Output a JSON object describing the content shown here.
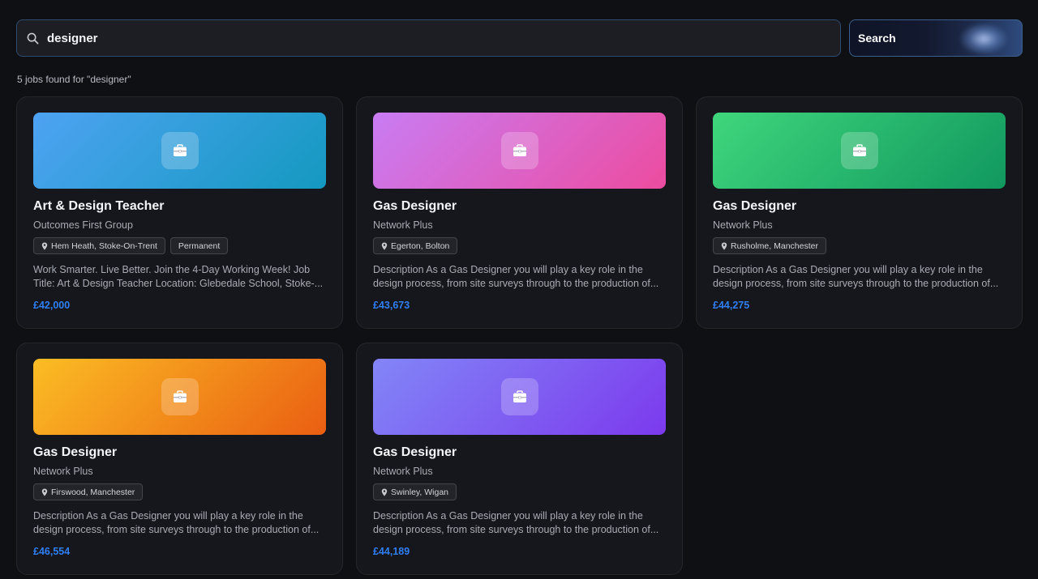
{
  "search": {
    "value": "designer",
    "placeholder": "",
    "button_label": "Search"
  },
  "results_count": "5 jobs found for \"designer\"",
  "colors": {
    "accent": "#2f7ff5",
    "background": "#0f1014",
    "card": "#16171c"
  },
  "jobs": [
    {
      "title": "Art & Design Teacher",
      "company": "Outcomes First Group",
      "location": "Hem Heath, Stoke-On-Trent",
      "contract": "Permanent",
      "description": "Work Smarter. Live Better. Join the 4-Day Working Week! Job Title: Art & Design Teacher Location: Glebedale School, Stoke-...",
      "salary": "£42,000",
      "banner_gradient": [
        "#4ea3f2",
        "#1499c0"
      ],
      "icon": "briefcase-icon"
    },
    {
      "title": "Gas Designer",
      "company": "Network Plus",
      "location": "Egerton, Bolton",
      "contract": "",
      "description": "Description As a Gas Designer you will play a key role in the design process, from site surveys through to the production of...",
      "salary": "£43,673",
      "banner_gradient": [
        "#c97cf4",
        "#ec4c9f"
      ],
      "icon": "briefcase-icon"
    },
    {
      "title": "Gas Designer",
      "company": "Network Plus",
      "location": "Rusholme, Manchester",
      "contract": "",
      "description": "Description As a Gas Designer you will play a key role in the design process, from site surveys through to the production of...",
      "salary": "£44,275",
      "banner_gradient": [
        "#3fd67c",
        "#11985f"
      ],
      "icon": "briefcase-icon"
    },
    {
      "title": "Gas Designer",
      "company": "Network Plus",
      "location": "Firswood, Manchester",
      "contract": "",
      "description": "Description As a Gas Designer you will play a key role in the design process, from site surveys through to the production of...",
      "salary": "£46,554",
      "banner_gradient": [
        "#fbbd24",
        "#ea5e12"
      ],
      "icon": "briefcase-icon"
    },
    {
      "title": "Gas Designer",
      "company": "Network Plus",
      "location": "Swinley, Wigan",
      "contract": "",
      "description": "Description As a Gas Designer you will play a key role in the design process, from site surveys through to the production of...",
      "salary": "£44,189",
      "banner_gradient": [
        "#8286f7",
        "#7c3aed"
      ],
      "icon": "briefcase-icon"
    }
  ]
}
